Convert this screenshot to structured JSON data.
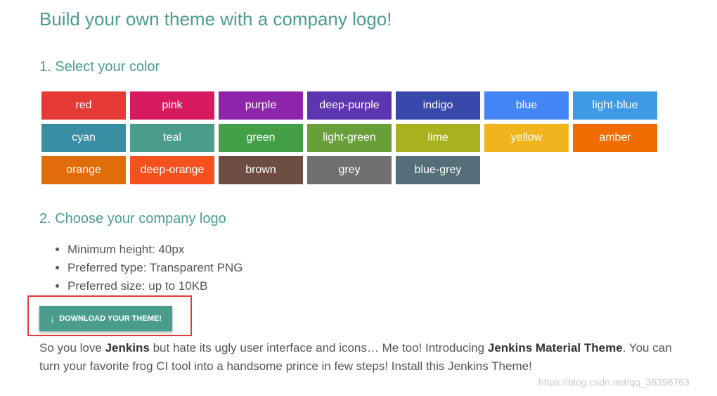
{
  "title": "Build your own theme with a company logo!",
  "step1": {
    "heading": "1. Select your color",
    "colors": [
      {
        "label": "red",
        "hex": "#e53935"
      },
      {
        "label": "pink",
        "hex": "#d81b60"
      },
      {
        "label": "purple",
        "hex": "#8e24aa"
      },
      {
        "label": "deep-purple",
        "hex": "#5e35b1"
      },
      {
        "label": "indigo",
        "hex": "#3949ab"
      },
      {
        "label": "blue",
        "hex": "#4285f4"
      },
      {
        "label": "light-blue",
        "hex": "#3f9ae6"
      },
      {
        "label": "cyan",
        "hex": "#3a8ea3"
      },
      {
        "label": "teal",
        "hex": "#4a9d8c"
      },
      {
        "label": "green",
        "hex": "#43a047"
      },
      {
        "label": "light-green",
        "hex": "#689f38"
      },
      {
        "label": "lime",
        "hex": "#a9b11e"
      },
      {
        "label": "yellow",
        "hex": "#f0b41c"
      },
      {
        "label": "amber",
        "hex": "#ef6c00"
      },
      {
        "label": "orange",
        "hex": "#e06d0a"
      },
      {
        "label": "deep-orange",
        "hex": "#f4511e"
      },
      {
        "label": "brown",
        "hex": "#6d4c41"
      },
      {
        "label": "grey",
        "hex": "#707070"
      },
      {
        "label": "blue-grey",
        "hex": "#546e7a"
      }
    ]
  },
  "step2": {
    "heading": "2. Choose your company logo",
    "requirements": [
      "Minimum height: 40px",
      "Preferred type: Transparent PNG",
      "Preferred size: up to 10KB"
    ]
  },
  "download_button": {
    "label": "DOWNLOAD YOUR THEME!",
    "icon": "arrow-down-icon"
  },
  "intro": {
    "part1": "So you love ",
    "bold1": "Jenkins",
    "part2": " but hate its ugly user interface and icons… Me too! Introducing ",
    "bold2": "Jenkins Material Theme",
    "part3": ". You can turn your favorite frog CI tool into a handsome prince in few steps! Install this Jenkins Theme!"
  },
  "watermark": "https://blog.csdn.net/qq_36396763"
}
